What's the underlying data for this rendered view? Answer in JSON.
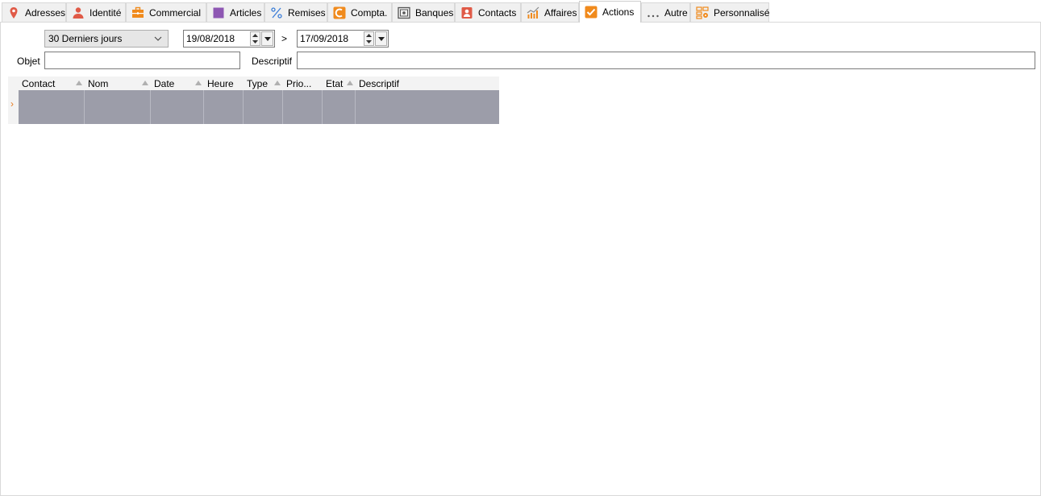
{
  "tabs": [
    {
      "label": "Adresses",
      "icon": "map-pin-icon",
      "color": "#e05a47"
    },
    {
      "label": "Identité",
      "icon": "person-icon",
      "color": "#e05a47"
    },
    {
      "label": "Commercial",
      "icon": "briefcase-icon",
      "color": "#f08a1c"
    },
    {
      "label": "Articles",
      "icon": "square-icon",
      "color": "#8e57b3"
    },
    {
      "label": "Remises",
      "icon": "percent-icon",
      "color": "#3b7dd8"
    },
    {
      "label": "Compta.",
      "icon": "c-logo-icon",
      "color": "#f08a1c"
    },
    {
      "label": "Banques",
      "icon": "safe-icon",
      "color": "#555555"
    },
    {
      "label": "Contacts",
      "icon": "contact-card-icon",
      "color": "#e05a47"
    },
    {
      "label": "Affaires",
      "icon": "trend-chart-icon",
      "color": "#f08a1c"
    },
    {
      "label": "Actions",
      "icon": "checkbox-icon",
      "color": "#f08a1c"
    },
    {
      "label": "Autre",
      "icon": "ellipsis-icon",
      "color": "#555555"
    },
    {
      "label": "Personnalisé",
      "icon": "custom-grid-icon",
      "color": "#f08a1c"
    }
  ],
  "active_tab": "Actions",
  "filter": {
    "period": "30 Derniers jours",
    "date_from": "19/08/2018",
    "separator": ">",
    "date_to": "17/09/2018",
    "objet_label": "Objet",
    "objet_value": "",
    "descriptif_label": "Descriptif",
    "descriptif_value": ""
  },
  "grid": {
    "columns": [
      "Contact",
      "Nom",
      "Date",
      "Heure",
      "Type",
      "Prio...",
      "Etat",
      "Descriptif"
    ],
    "row_indicator": "›"
  },
  "colors": {
    "accent": "#f08a1c",
    "grid_row": "#9c9da9",
    "tab_bg": "#f0f0f0"
  }
}
